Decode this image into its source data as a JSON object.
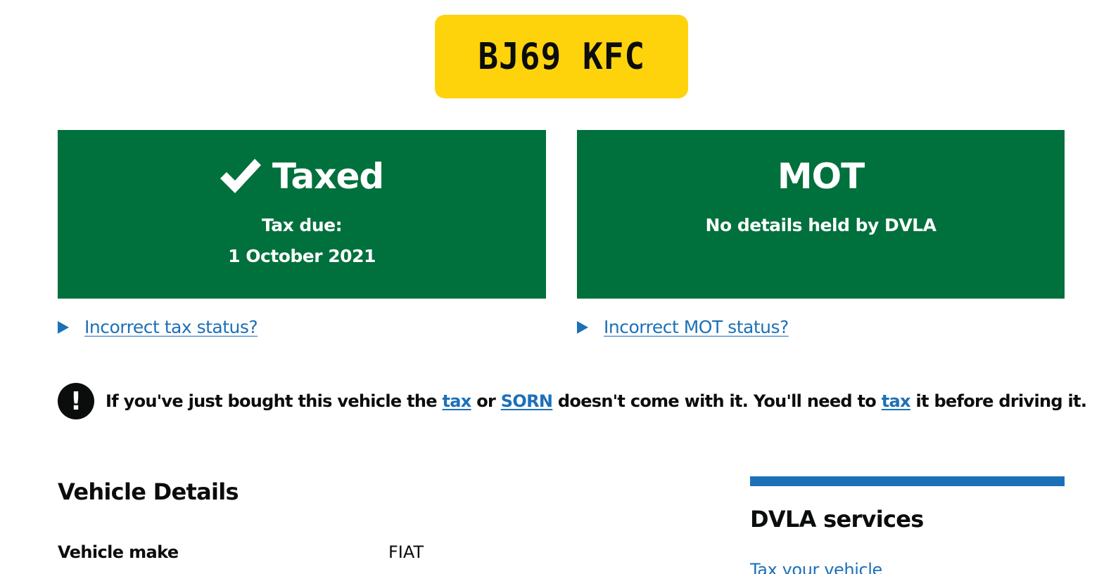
{
  "registration_plate": "BJ69 KFC",
  "tax_panel": {
    "heading": "Taxed",
    "icon": "check-icon",
    "due_label": "Tax due:",
    "due_date": "1 October 2021"
  },
  "mot_panel": {
    "heading": "MOT",
    "status": "No details held by DVLA"
  },
  "tax_details_link": "Incorrect tax status?",
  "mot_details_link": "Incorrect MOT status?",
  "warning": {
    "icon": "exclamation-icon",
    "text_1": "If you've just bought this vehicle the ",
    "link_tax": "tax",
    "text_2": " or ",
    "link_sorn": "SORN",
    "text_3": " doesn't come with it. You'll need to ",
    "link_tax_2": "tax",
    "text_4": " it before driving it."
  },
  "vehicle_details": {
    "heading": "Vehicle Details",
    "rows": [
      {
        "key": "Vehicle make",
        "value": "FIAT"
      }
    ]
  },
  "sidebar": {
    "heading": "DVLA services",
    "links": [
      "Tax your vehicle"
    ]
  },
  "colors": {
    "plate_yellow": "#ffd30c",
    "panel_green": "#00703c",
    "link_blue": "#1d70b8",
    "text_black": "#0b0c0c"
  }
}
